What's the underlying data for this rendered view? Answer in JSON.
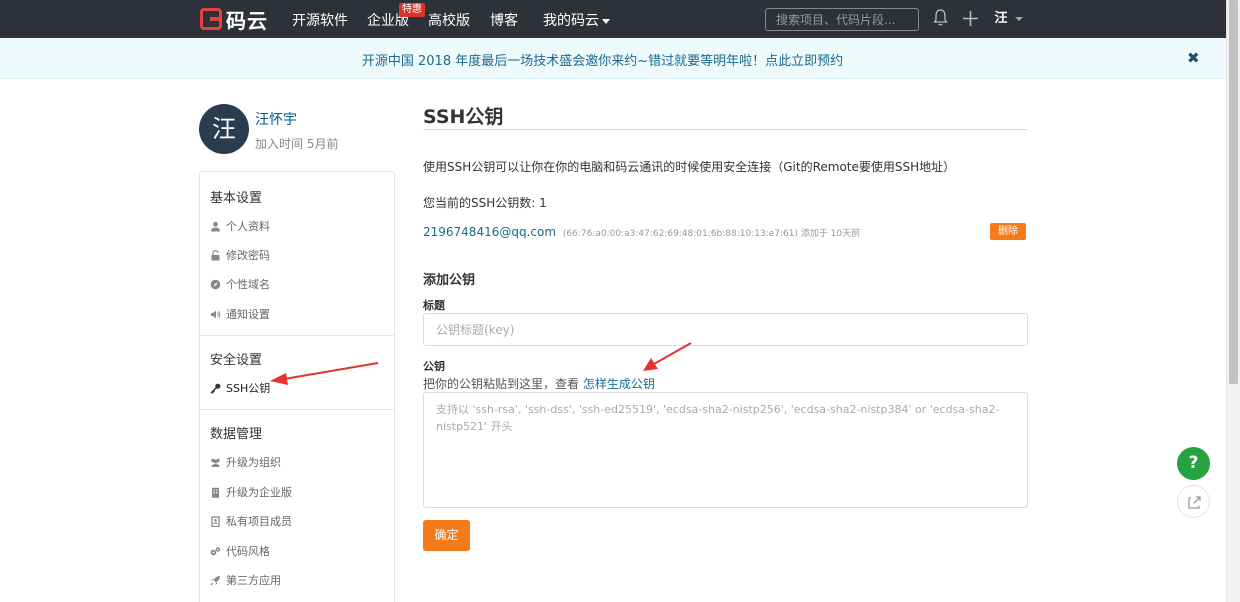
{
  "nav": {
    "logo_text": "码云",
    "items": [
      "开源软件",
      "企业版",
      "高校版",
      "博客",
      "我的码云"
    ],
    "badge": "特惠",
    "search_placeholder": "搜索项目、代码片段...",
    "avatar_char": "汪"
  },
  "banner": {
    "text": "开源中国 2018 年度最后一场技术盛会邀你来约~错过就要等明年啦！点此立即预约",
    "close": "✖"
  },
  "profile": {
    "avatar_char": "汪",
    "name": "汪怀宇",
    "join": "加入时间 5月前"
  },
  "sidebar": {
    "groups": [
      "基本设置",
      "安全设置",
      "数据管理"
    ],
    "items": [
      "个人资料",
      "修改密码",
      "个性域名",
      "通知设置",
      "SSH公钥",
      "升级为组织",
      "升级为企业版",
      "私有项目成员",
      "代码风格",
      "第三方应用"
    ]
  },
  "main": {
    "title": "SSH公钥",
    "description": "使用SSH公钥可以让你在你的电脑和码云通讯的时候使用安全连接（Git的Remote要使用SSH地址）",
    "key_count": "您当前的SSH公钥数: 1",
    "key": {
      "email": "2196748416@qq.com",
      "fingerprint": "(66:76:a0:00:a3:47:62:69:48:01:6b:88:10:13:e7:61) 添加于 10天前",
      "delete": "删除"
    },
    "add_title": "添加公钥",
    "title_label": "标题",
    "title_placeholder": "公钥标题(key)",
    "key_label": "公钥",
    "hint": "把你的公钥粘贴到这里，查看 ",
    "hint_link": "怎样生成公钥",
    "key_placeholder": "支持以 'ssh-rsa', 'ssh-dss', 'ssh-ed25519', 'ecdsa-sha2-nistp256', 'ecdsa-sha2-nistp384' or 'ecdsa-sha2-nistp521' 开头",
    "confirm": "确定"
  },
  "floating": {
    "help": "?"
  },
  "colors": {
    "accent": "#f57a1a",
    "nav_bg": "#2e3138",
    "link": "#1b6a8f",
    "help": "#27a243",
    "annotation": "#e8322f"
  }
}
